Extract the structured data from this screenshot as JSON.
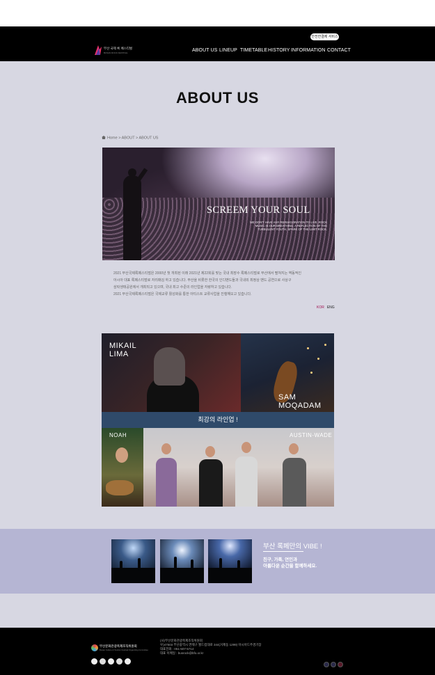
{
  "header": {
    "logo": {
      "line1": "부산 국제 록 페스티벌",
      "line2": "BUSAN ROCK FESTIVAL"
    },
    "pill_label": "안전한결제 서비스",
    "nav": [
      "ABOUT US",
      "LINEUP",
      "TIMETABLE",
      "HISTORY",
      "INFORMATION",
      "CONTACT"
    ]
  },
  "page": {
    "title": "ABOUT US",
    "breadcrumb": "Home > ABOUT > ABOUT US"
  },
  "hero": {
    "title": "SCREEM YOUR SOUL",
    "subtitle": "WE DON'T HAVE ANY REINVIGORATION TO LIVE, ROCK MUSIC IS OUR BREATHING, A REFLECTION OF THE TURBULENT YOUTH, SPARK OF THE LIMIT ROCK."
  },
  "description": [
    "2021 부산국제록페스티벌은 2000년 첫 개최된 이래 2021년 제22회를 맞는 국내 최장수 록페스티벌로 부산에서 펼쳐지는 역동적인",
    "아시아 대표 록페스티벌로 자리매김 하고 있습니다. 부산을 비롯한 한국의 인디밴드들과 국내외 최정상 밴드 공연으로 사상구",
    "삼락생태공원에서 개최되고 있으며, 국내 최고 수준의 라인업을 자랑하고 있습니다.",
    "2021 부산국제록페스티벌은 국제교류 활성화를 통한 아티스트 교류사업을 진행해오고 있습니다."
  ],
  "lang": {
    "kor": "KOR",
    "eng": "ENG"
  },
  "lineup": {
    "artist1": "MIKAIL\nLIMA",
    "artist2": "SAM\nMOQADAM",
    "banner": "최강의 라인업 !",
    "artist3": "NOAH",
    "artist4": "AUSTIN-WADE"
  },
  "vibe": {
    "title": "부산 록페만의 VIBE !",
    "desc_line1": "친구, 가족, 연인과",
    "desc_line2": "아름다운 순간을 함께하세요."
  },
  "footer": {
    "logo_line1": "부산문화관광축제조직위원회",
    "logo_line2": "Busan Culture & Tourism Festival Organizing Committee",
    "info": [
      "(사)부산문화관광축제조직위원회",
      "우)47503 부산광역시 연제구 월드컵대로 344(거제동 1299) 아시아드주경기장",
      "대표전화 : 051-507-5714",
      "대표 이메일 : busrock@bfo.or.kr"
    ]
  },
  "colors": {
    "header_bg": "#000000",
    "page_bg": "#d7d7e2",
    "vibe_bg": "#b5b5d3",
    "lineup_banner": "#2f4a6a",
    "kor_active": "#a01050"
  }
}
